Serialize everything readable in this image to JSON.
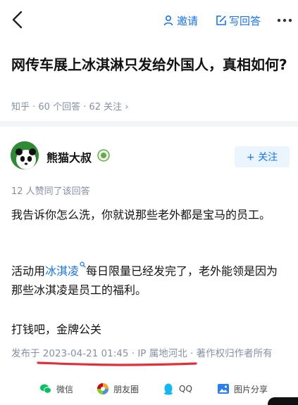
{
  "nav": {
    "invite_label": "邀请",
    "write_answer_label": "写回答"
  },
  "question": {
    "title": "网传车展上冰淇淋只发给外国人，真相如何?",
    "meta": "知乎 · 60 个回答 · 62 关注 ›"
  },
  "author": {
    "name": "熊猫大叔",
    "follow_label": "+ 关注"
  },
  "answer": {
    "agree_text": "12 人赞同了该回答",
    "para1": "我告诉你怎么洗，你就说那些老外都是宝马的员工。",
    "para2_before": "活动用",
    "para2_link": "冰淇凌",
    "para2_after": "每日限量已经发完了，老外能领是因为那些冰淇凌是员工的福利。",
    "para3": "打钱吧，金牌公关",
    "publish_info": "发布于 2023-04-21 01:45 · IP 属地河北 · 著作权归作者所有"
  },
  "share": {
    "items": [
      {
        "label": "微信",
        "icon": "wechat-icon"
      },
      {
        "label": "朋友圈",
        "icon": "moments-icon"
      },
      {
        "label": "QQ",
        "icon": "qq-icon"
      },
      {
        "label": "图片分享",
        "icon": "image-share-icon"
      }
    ]
  },
  "colors": {
    "accent": "#1772f6",
    "muted": "#8590a6",
    "annotation_red": "#e0303c"
  }
}
